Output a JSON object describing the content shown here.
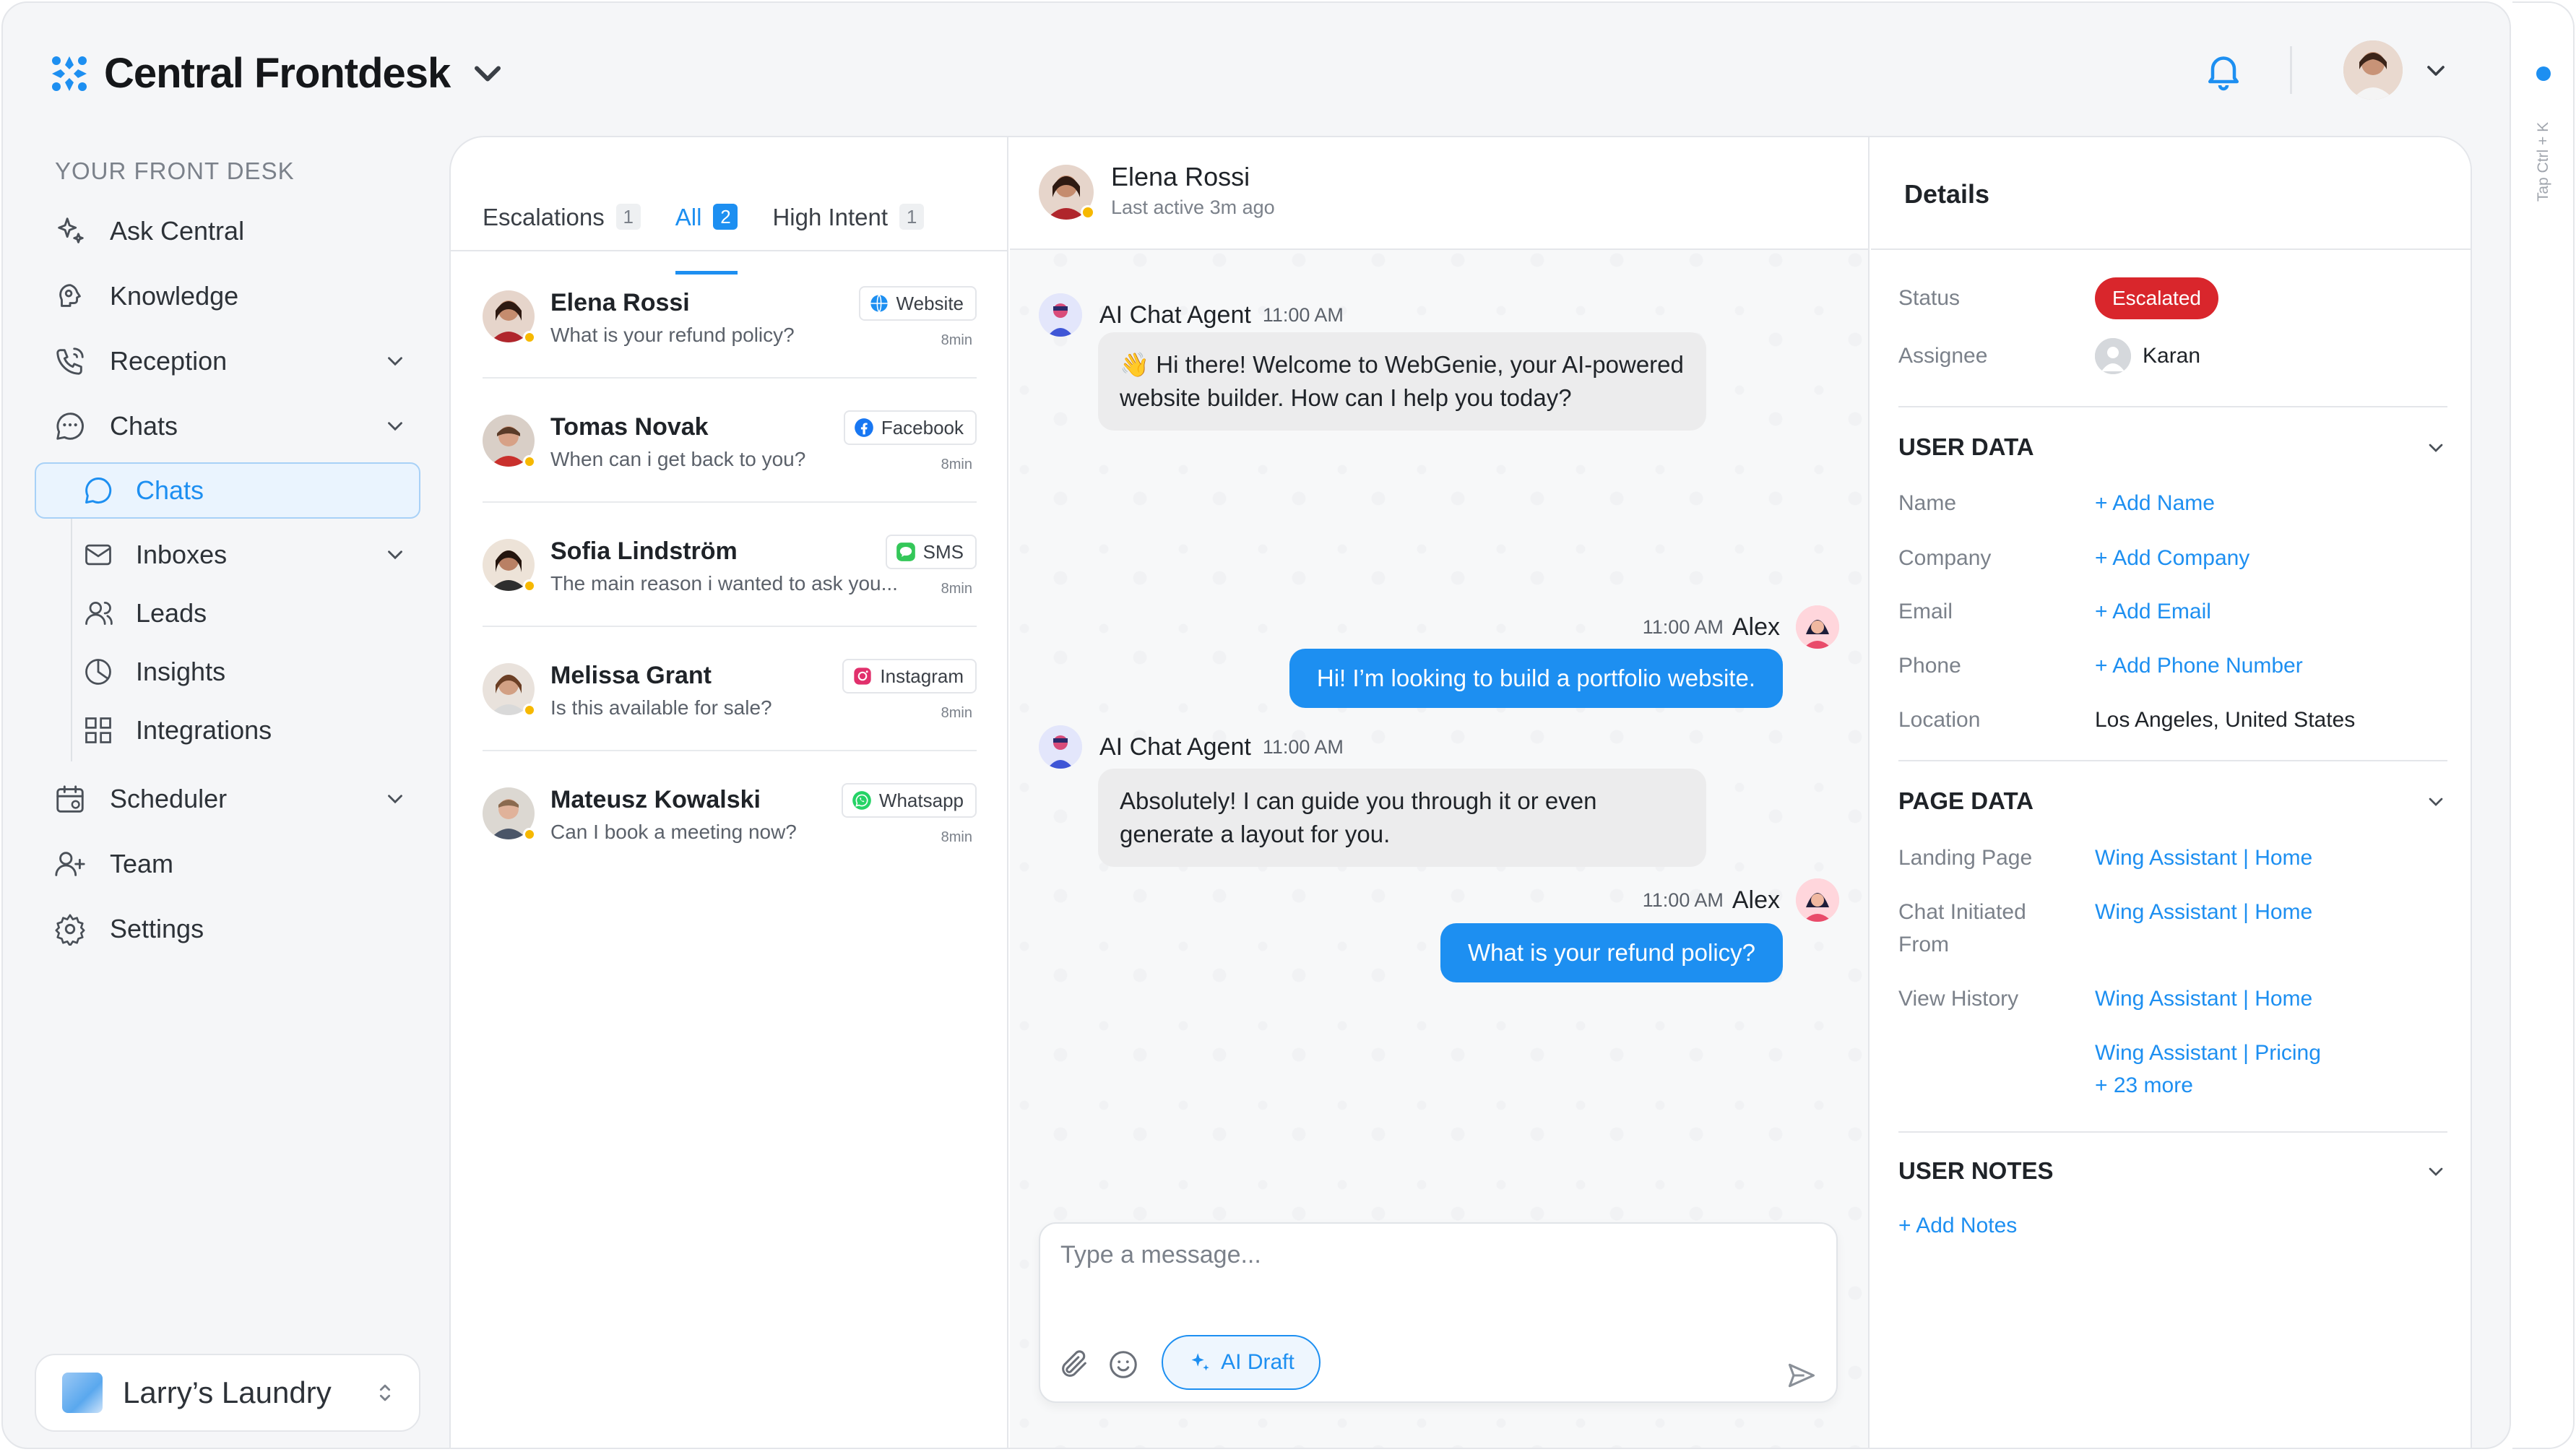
{
  "app": {
    "brand": "Central Frontdesk",
    "accent": "#1d8ff1",
    "rail_hint": "Tap Ctrl + K"
  },
  "sidebar": {
    "section_title": "YOUR FRONT DESK",
    "items": [
      {
        "label": "Ask Central",
        "icon": "sparkle-icon"
      },
      {
        "label": "Knowledge",
        "icon": "brain-icon"
      },
      {
        "label": "Reception",
        "icon": "phone-icon",
        "expandable": true
      },
      {
        "label": "Chats",
        "icon": "chat-bubble-icon",
        "expandable": true
      },
      {
        "label": "Scheduler",
        "icon": "calendar-icon",
        "expandable": true
      },
      {
        "label": "Team",
        "icon": "team-icon"
      },
      {
        "label": "Settings",
        "icon": "gear-icon"
      }
    ],
    "sub_items": [
      {
        "label": "Chats",
        "icon": "chat-bubble-icon",
        "active": true
      },
      {
        "label": "Inboxes",
        "icon": "mail-icon",
        "expandable": true
      },
      {
        "label": "Leads",
        "icon": "users-icon"
      },
      {
        "label": "Insights",
        "icon": "pie-chart-icon"
      },
      {
        "label": "Integrations",
        "icon": "grid-icon"
      }
    ],
    "workspace": "Larry’s Laundry"
  },
  "conversation_list": {
    "tabs": [
      {
        "label": "Escalations",
        "count": "1"
      },
      {
        "label": "All",
        "count": "2",
        "active": true
      },
      {
        "label": "High Intent",
        "count": "1"
      }
    ],
    "conversations": [
      {
        "name": "Elena Rossi",
        "message": "What is your refund policy?",
        "source": "Website",
        "source_icon": "globe-icon",
        "time": "8min"
      },
      {
        "name": "Tomas Novak",
        "message": "When can i get back to you?",
        "source": "Facebook",
        "source_icon": "facebook-icon",
        "time": "8min"
      },
      {
        "name": "Sofia Lindström",
        "message": "The main reason i wanted to ask you...",
        "source": "SMS",
        "source_icon": "sms-icon",
        "time": "8min"
      },
      {
        "name": "Melissa Grant",
        "message": "Is this available for sale?",
        "source": "Instagram",
        "source_icon": "instagram-icon",
        "time": "8min"
      },
      {
        "name": "Mateusz Kowalski",
        "message": "Can I book a meeting now?",
        "source": "Whatsapp",
        "source_icon": "whatsapp-icon",
        "time": "8min"
      }
    ]
  },
  "chat": {
    "contact_name": "Elena Rossi",
    "last_active": "Last active 3m ago",
    "messages": [
      {
        "from": "AI Chat Agent",
        "time": "11:00 AM",
        "text": "👋 Hi there! Welcome to WebGenie, your AI-powered website builder. How can I help you today?"
      },
      {
        "from": "Alex",
        "time": "11:00 AM",
        "text": "Hi! I’m looking to build a portfolio website."
      },
      {
        "from": "AI Chat Agent",
        "time": "11:00 AM",
        "text": "Absolutely! I can guide you through it or even generate a layout for you."
      },
      {
        "from": "Alex",
        "time": "11:00 AM",
        "text": "What is your refund policy?"
      }
    ],
    "composer": {
      "placeholder": "Type a message...",
      "ai_draft_label": "AI Draft"
    }
  },
  "details": {
    "title": "Details",
    "status_label": "Status",
    "status_value": "Escalated",
    "status_color": "#d9262c",
    "assignee_label": "Assignee",
    "assignee_value": "Karan",
    "user_data": {
      "title": "USER DATA",
      "name_label": "Name",
      "name_value": "+ Add Name",
      "company_label": "Company",
      "company_value": "+ Add Company",
      "email_label": "Email",
      "email_value": "+ Add Email",
      "phone_label": "Phone",
      "phone_value": "+ Add Phone Number",
      "location_label": "Location",
      "location_value": "Los Angeles, United States"
    },
    "page_data": {
      "title": "PAGE DATA",
      "landing_label": "Landing Page",
      "landing_value": "Wing Assistant | Home",
      "chat_init_label_1": "Chat Initiated",
      "chat_init_label_2": "From",
      "chat_init_value": "Wing Assistant | Home",
      "history_label": "View History",
      "history_1": "Wing Assistant | Home",
      "history_2": "Wing Assistant | Pricing",
      "history_more": "+ 23 more"
    },
    "user_notes": {
      "title": "USER NOTES",
      "add": "+ Add Notes"
    }
  }
}
